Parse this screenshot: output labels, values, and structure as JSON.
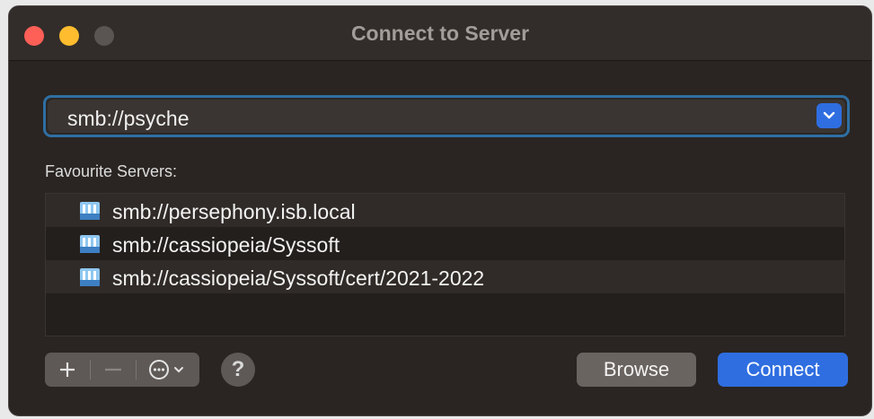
{
  "window": {
    "title": "Connect to Server"
  },
  "server_address": {
    "value": "smb://psyche"
  },
  "favourites": {
    "label": "Favourite Servers:",
    "items": [
      {
        "label": "smb://persephony.isb.local"
      },
      {
        "label": "smb://cassiopeia/Syssoft"
      },
      {
        "label": "smb://cassiopeia/Syssoft/cert/2021-2022"
      }
    ]
  },
  "toolbar": {
    "add_icon": "plus-icon",
    "remove_icon": "minus-icon",
    "more_icon": "ellipsis-circle-icon",
    "help_label": "?"
  },
  "buttons": {
    "browse_label": "Browse",
    "connect_label": "Connect"
  },
  "colors": {
    "accent": "#2f6ee0",
    "focus_ring": "#2f6fa3",
    "close": "#fe5f57",
    "minimize": "#febc2e"
  }
}
